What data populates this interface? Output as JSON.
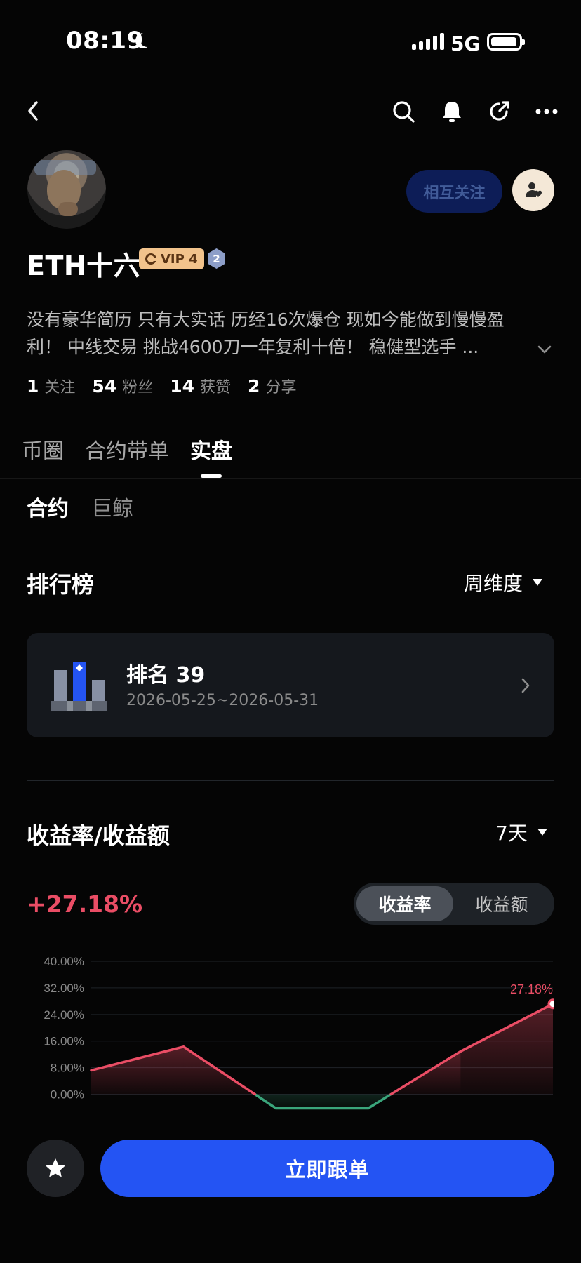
{
  "status_bar": {
    "time": "08:19",
    "network": "5G"
  },
  "profile": {
    "name": "ETH十六",
    "vip_label": "VIP 4",
    "level": "2",
    "follow_button": "相互关注",
    "bio_line1": "没有豪华简历  只有大实话 历经16次爆仓 现如今能做到慢慢盈",
    "bio_line2": "利！ 中线交易 挑战4600刀一年复利十倍！   稳健型选手 ...",
    "stats": [
      {
        "value": "1",
        "label": "关注"
      },
      {
        "value": "54",
        "label": "粉丝"
      },
      {
        "value": "14",
        "label": "获赞"
      },
      {
        "value": "2",
        "label": "分享"
      }
    ]
  },
  "tabs": [
    "币圈",
    "合约带单",
    "实盘"
  ],
  "subtabs": [
    "合约",
    "巨鲸"
  ],
  "ranking": {
    "title": "排行榜",
    "period": "周维度",
    "rank_label": "排名 39",
    "date_range": "2026-05-25~2026-05-31"
  },
  "profit": {
    "title": "收益率/收益额",
    "range": "7天",
    "value": "+27.18%",
    "toggle": [
      "收益率",
      "收益额"
    ]
  },
  "chart_data": {
    "type": "line",
    "y_ticks": [
      "40.00%",
      "32.00%",
      "24.00%",
      "16.00%",
      "8.00%",
      "0.00%"
    ],
    "ylim": [
      -6,
      40
    ],
    "series": [
      {
        "values": [
          7.2,
          14.3,
          -4.2,
          -4.2,
          12.9,
          27.18
        ]
      }
    ],
    "annotation": "27.18%",
    "colors": {
      "positive": "#ea4d65",
      "negative": "#3aa57b"
    }
  },
  "bottom_bar": {
    "favorite_icon": "star-icon",
    "main_button": "立即跟单"
  },
  "icons": {
    "back": "chevron-left-icon",
    "search": "search-icon",
    "bell": "bell-icon",
    "share": "share-icon",
    "more": "more-icon",
    "follow_user": "user-heart-icon"
  },
  "colors": {
    "accent": "#2454f3",
    "profit": "#ea4d65"
  }
}
